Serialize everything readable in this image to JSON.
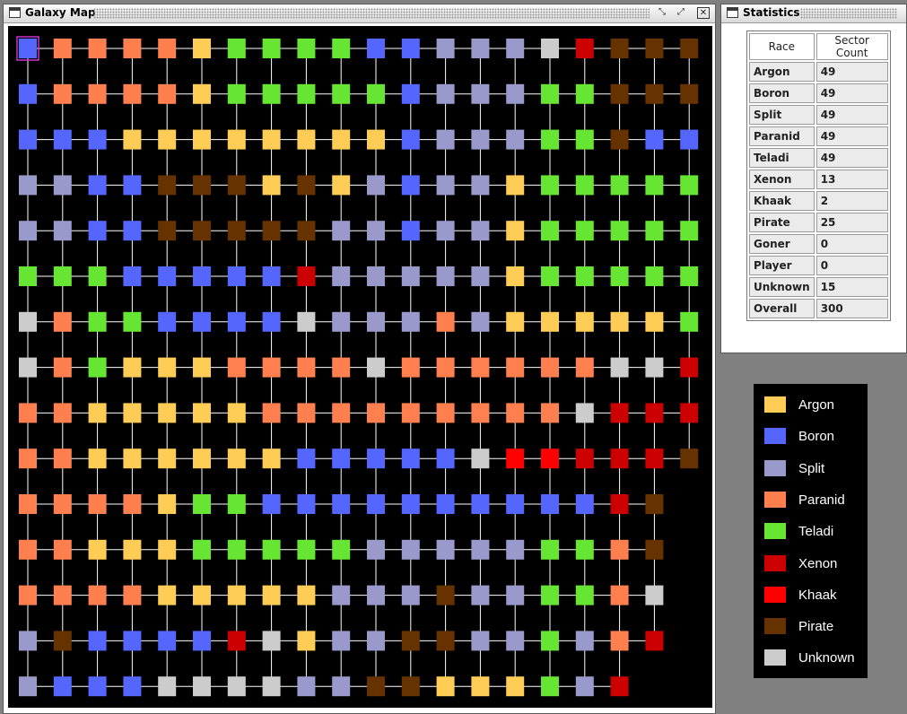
{
  "map_window": {
    "title": "Galaxy Map",
    "minimize_glyph": "⤡",
    "maximize_glyph": "⤢",
    "close_glyph": "✕",
    "selected_sector": {
      "row": 0,
      "col": 0
    },
    "colors": {
      "Argon": "#FFCC55",
      "Boron": "#5566FF",
      "Split": "#9999CC",
      "Paranid": "#FF7F4F",
      "Teladi": "#66E633",
      "Xenon": "#CC0000",
      "Khaak": "#FF0000",
      "Pirate": "#663300",
      "Unknown": "#CCCCCC",
      "selection": "#CC33CC",
      "link": "#FFFFFF"
    },
    "sector_codes": {
      "A": "Argon",
      "B": "Boron",
      "S": "Split",
      "P": "Paranid",
      "T": "Teladi",
      "X": "Xenon",
      "K": "Khaak",
      "R": "Pirate",
      "U": "Unknown"
    },
    "grid": [
      "BPPPPATTTTBBSSSUXRRR",
      "BPPPPATTTTTBSSSTTRRR",
      "BBBAAAAAAAABSSSTTRBB",
      "SSBBRRRARASBSSATTTTT",
      "SSBBRRRRRSSBSSATTTTT",
      "TTTBBBBBXSSSSSATTTTT",
      "UPTTBBBBUSSSPSAAAAAT",
      "UPTAAAPPPPUPPPPPPUUX",
      "PPAAAAAPPPPPPPPPUXXX",
      "PPAAAAAABBBBBUKKXXXR",
      "PPPPATTBBBBBBBBBBXR",
      "PPAAATTTTTSSSSSTTPR",
      "PPPPAAAAASSSRSSTTPU",
      "SRBBBBXUASSRRSSTSPX",
      "SBBBUUUUSSRRAAATSX"
    ]
  },
  "stats_window": {
    "title": "Statistics",
    "headers": [
      "Race",
      "Sector Count"
    ],
    "rows": [
      [
        "Argon",
        "49"
      ],
      [
        "Boron",
        "49"
      ],
      [
        "Split",
        "49"
      ],
      [
        "Paranid",
        "49"
      ],
      [
        "Teladi",
        "49"
      ],
      [
        "Xenon",
        "13"
      ],
      [
        "Khaak",
        "2"
      ],
      [
        "Pirate",
        "25"
      ],
      [
        "Goner",
        "0"
      ],
      [
        "Player",
        "0"
      ],
      [
        "Unknown",
        "15"
      ],
      [
        "Overall",
        "300"
      ]
    ]
  },
  "legend": {
    "items": [
      {
        "label": "Argon",
        "color": "#FFCC55"
      },
      {
        "label": "Boron",
        "color": "#5566FF"
      },
      {
        "label": "Split",
        "color": "#9999CC"
      },
      {
        "label": "Paranid",
        "color": "#FF7F4F"
      },
      {
        "label": "Teladi",
        "color": "#66E633"
      },
      {
        "label": "Xenon",
        "color": "#CC0000"
      },
      {
        "label": "Khaak",
        "color": "#FF0000"
      },
      {
        "label": "Pirate",
        "color": "#663300"
      },
      {
        "label": "Unknown",
        "color": "#CCCCCC"
      }
    ]
  }
}
